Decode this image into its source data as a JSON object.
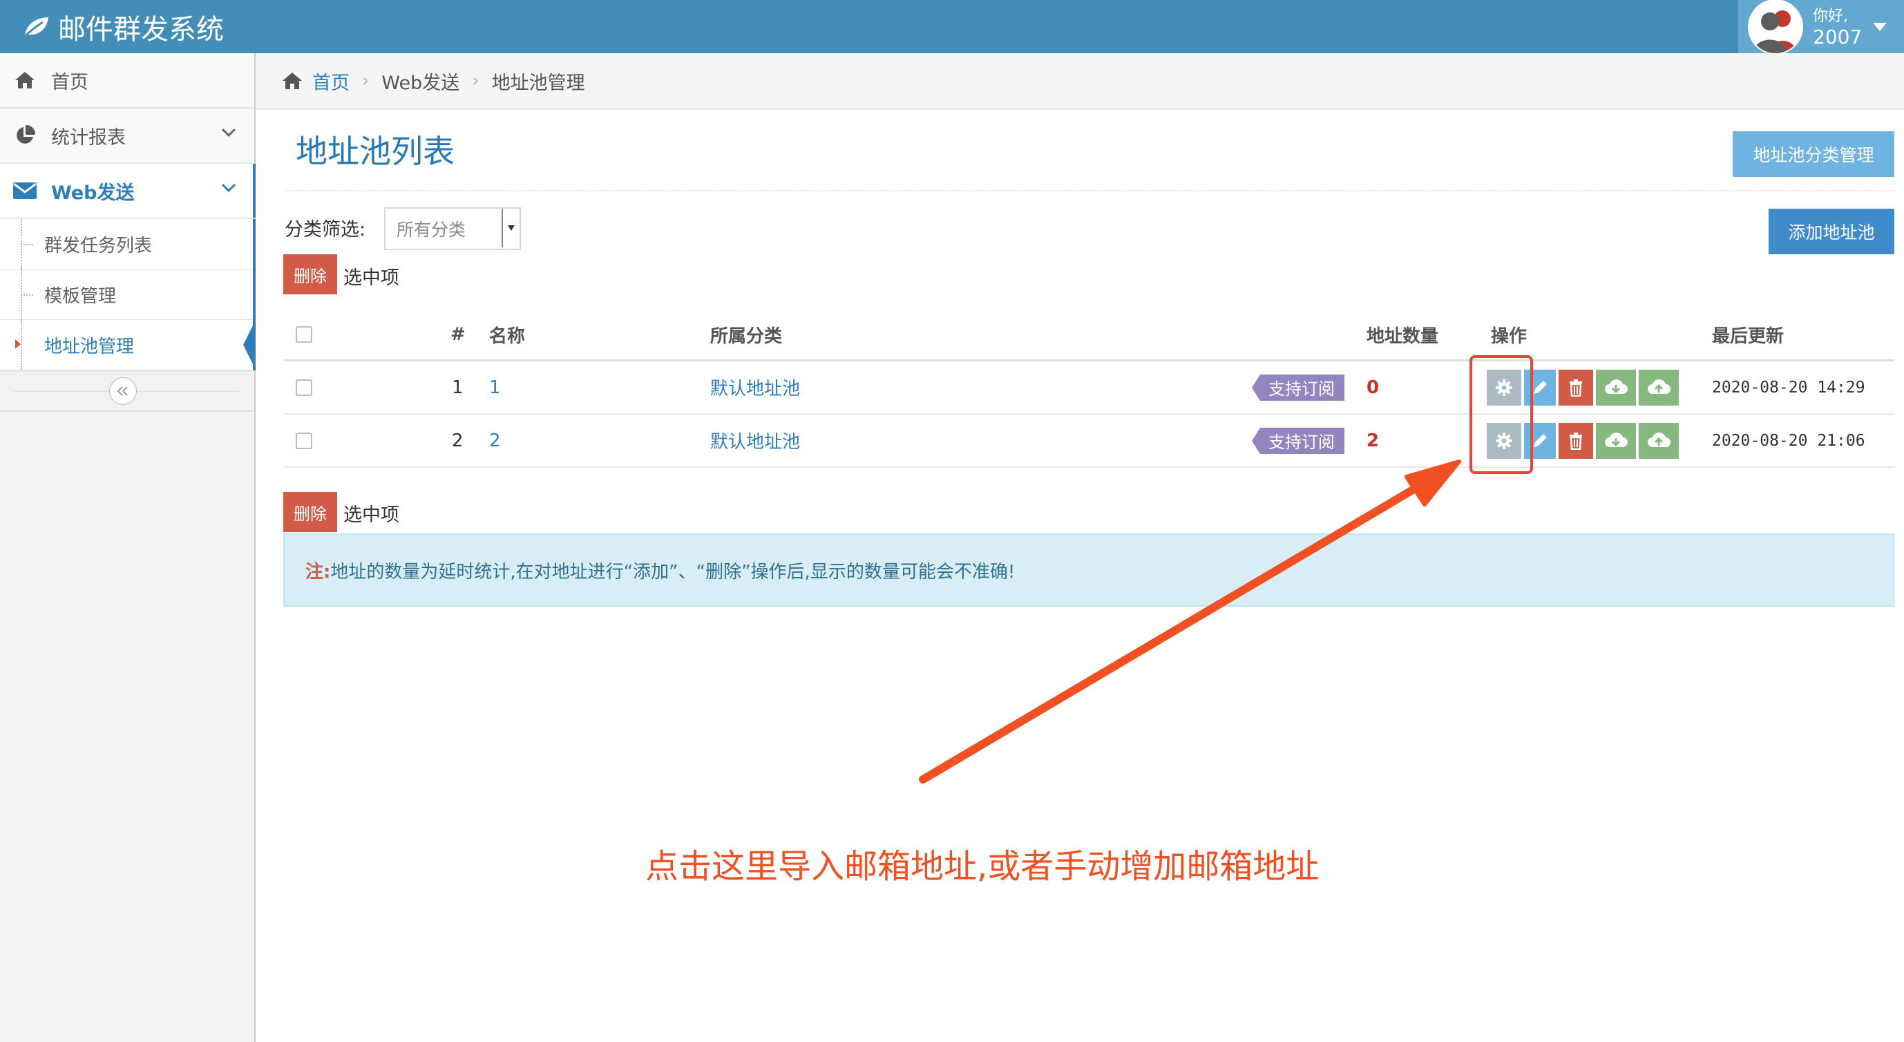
{
  "navbar": {
    "brand": "邮件群发系统",
    "user_greeting": "你好,",
    "user_name": "2007"
  },
  "sidebar": {
    "items": [
      {
        "label": "首页"
      },
      {
        "label": "统计报表"
      },
      {
        "label": "Web发送"
      }
    ],
    "submenu": [
      {
        "label": "群发任务列表"
      },
      {
        "label": "模板管理"
      },
      {
        "label": "地址池管理"
      }
    ]
  },
  "breadcrumb": {
    "home": "首页",
    "level2": "Web发送",
    "current": "地址池管理"
  },
  "page": {
    "title": "地址池列表",
    "category_manage_btn": "地址池分类管理",
    "add_btn": "添加地址池",
    "filter_label": "分类筛选:",
    "filter_value": "所有分类",
    "delete_btn": "删除",
    "selected_label": "选中项"
  },
  "table": {
    "headers": {
      "num": "#",
      "name": "名称",
      "category": "所属分类",
      "count": "地址数量",
      "ops": "操作",
      "updated": "最后更新"
    },
    "rows": [
      {
        "num": "1",
        "name": "1",
        "category": "默认地址池",
        "badge": "支持订阅",
        "count": "0",
        "updated": "2020-08-20 14:29"
      },
      {
        "num": "2",
        "name": "2",
        "category": "默认地址池",
        "badge": "支持订阅",
        "count": "2",
        "updated": "2020-08-20 21:06"
      }
    ]
  },
  "alert": {
    "label": "注:",
    "text": "地址的数量为延时统计,在对地址进行“添加”、“删除”操作后,显示的数量可能会不准确!"
  },
  "annotation": {
    "text": "点击这里导入邮箱地址,或者手动增加邮箱地址",
    "color": "#f05022"
  },
  "colors": {
    "navbar": "#438eb9",
    "accent": "#2b7dbc",
    "danger": "#d15b47",
    "badge": "#9585bf",
    "success": "#87b87f"
  }
}
